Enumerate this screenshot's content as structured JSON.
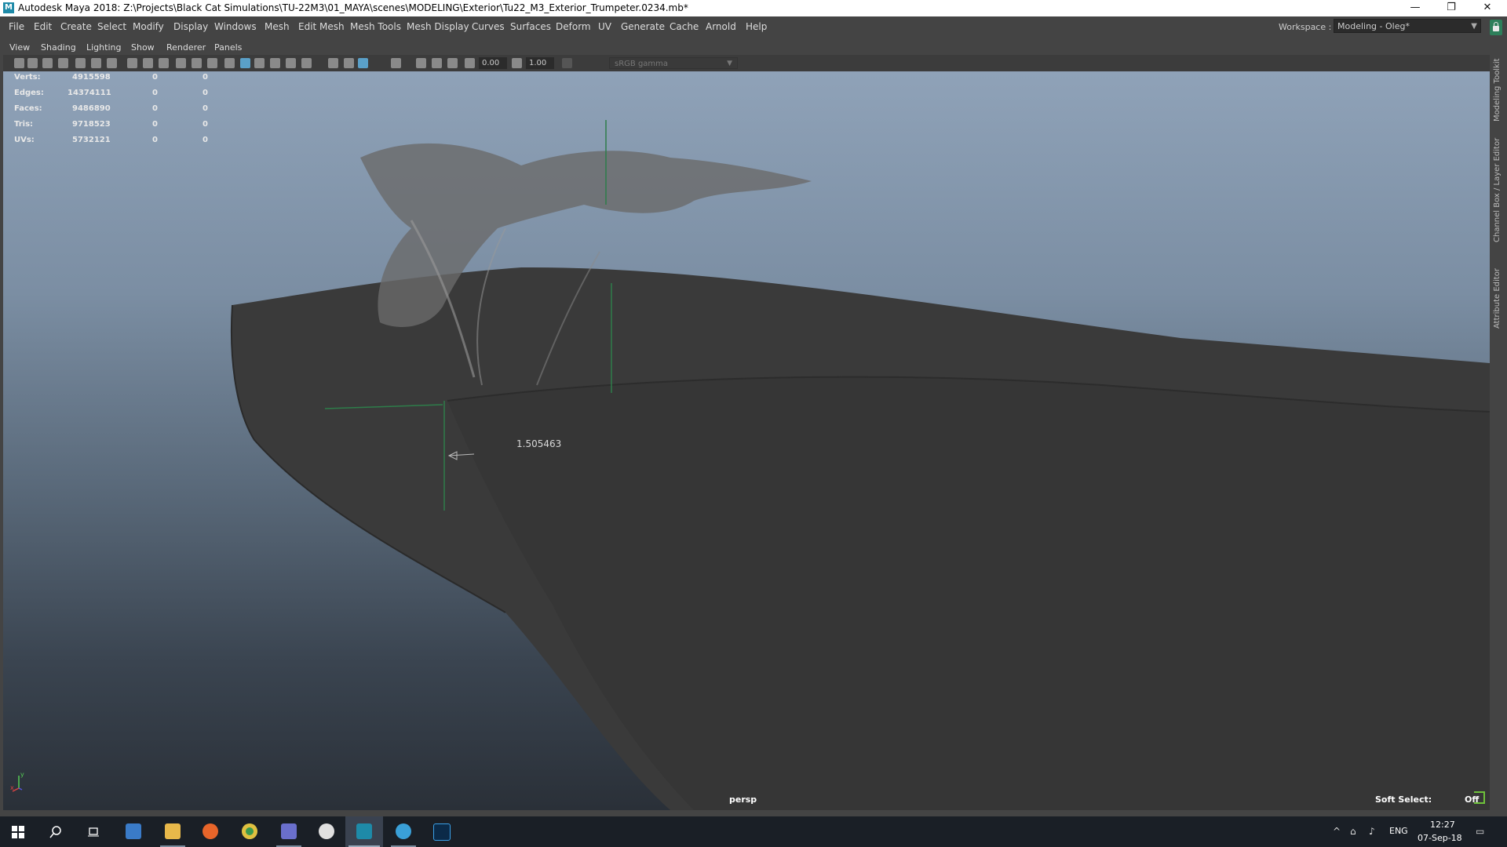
{
  "window": {
    "logo": "M",
    "title": "Autodesk Maya 2018: Z:\\Projects\\Black Cat Simulations\\TU-22M3\\01_MAYA\\scenes\\MODELING\\Exterior\\Tu22_M3_Exterior_Trumpeter.0234.mb*",
    "minimize": "—",
    "restore": "❐",
    "close": "✕"
  },
  "menubar": {
    "items": [
      "File",
      "Edit",
      "Create",
      "Select",
      "Modify",
      "Display",
      "Windows",
      "Mesh",
      "Edit Mesh",
      "Mesh Tools",
      "Mesh Display",
      "Curves",
      "Surfaces",
      "Deform",
      "UV",
      "Generate",
      "Cache",
      "Arnold",
      "Help"
    ],
    "workspace_label": "Workspace :",
    "workspace_value": "Modeling - Oleg*"
  },
  "panel": {
    "menu": [
      "View",
      "Shading",
      "Lighting",
      "Show",
      "Renderer",
      "Panels"
    ],
    "toolbar": {
      "field_1": "0.00",
      "field_2": "1.00",
      "colorspace": "sRGB gamma"
    }
  },
  "hud": {
    "rows": [
      {
        "label": "Verts:",
        "total": "4915598",
        "selected": "0",
        "component": "0"
      },
      {
        "label": "Edges:",
        "total": "14374111",
        "selected": "0",
        "component": "0"
      },
      {
        "label": "Faces:",
        "total": "9486890",
        "selected": "0",
        "component": "0"
      },
      {
        "label": "Tris:",
        "total": "9718523",
        "selected": "0",
        "component": "0"
      },
      {
        "label": "UVs:",
        "total": "5732121",
        "selected": "0",
        "component": "0"
      }
    ],
    "measure": "1.505463",
    "camera": "persp",
    "soft_select_label": "Soft Select:",
    "soft_select_value": "Off",
    "axis_y": "y",
    "axis_x": "x"
  },
  "sidetabs": [
    "Modeling Toolkit",
    "Channel Box / Layer Editor",
    "Attribute Editor"
  ],
  "taskbar": {
    "time": "12:27",
    "date": "07-Sep-18",
    "language": "ENG"
  },
  "colors": {
    "maya_bg": "#444444",
    "viewport_top": "#8fa2b8",
    "viewport_bottom": "#2a3038",
    "mesh": "#3a3a3a",
    "accent": "#5aa0c8",
    "taskbar": "#1a1f26"
  }
}
